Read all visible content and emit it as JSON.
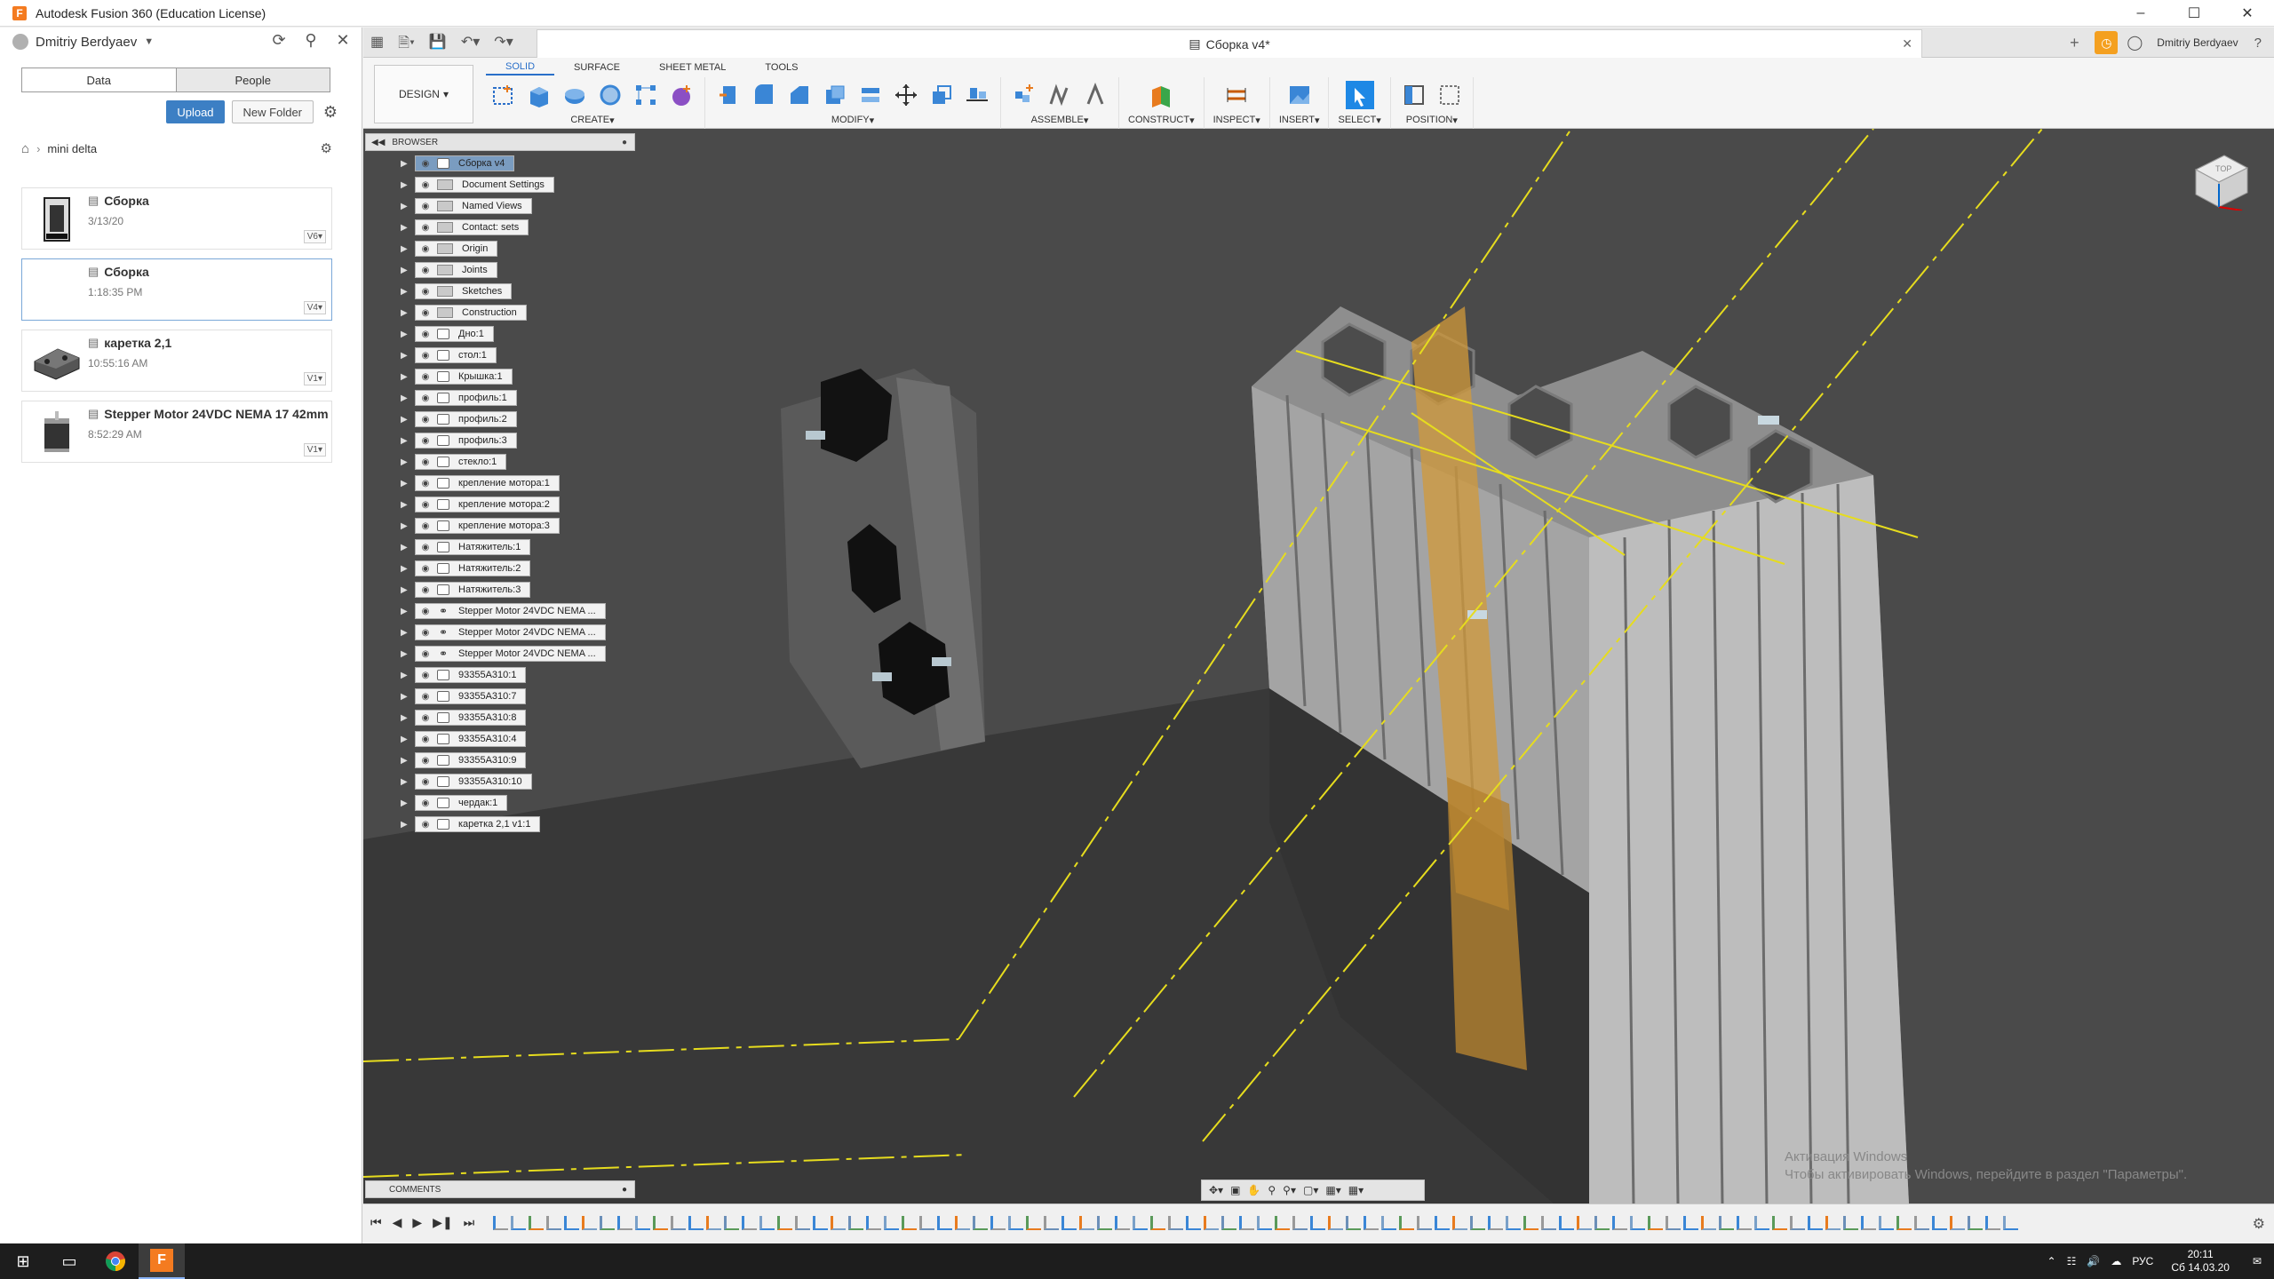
{
  "window": {
    "title": "Autodesk Fusion 360 (Education License)",
    "app_icon": "F"
  },
  "datapanel": {
    "user": "Dmitriy Berdyaev",
    "tabs": [
      "Data",
      "People"
    ],
    "upload_label": "Upload",
    "new_folder_label": "New Folder",
    "breadcrumb": "mini delta",
    "files": [
      {
        "name": "Сборка",
        "date": "3/13/20",
        "version": "V6"
      },
      {
        "name": "Сборка",
        "date": "1:18:35 PM",
        "version": "V4"
      },
      {
        "name": "каретка 2,1",
        "date": "10:55:16 AM",
        "version": "V1"
      },
      {
        "name": "Stepper Motor 24VDC NEMA 17 42mm",
        "date": "8:52:29 AM",
        "version": "V1"
      }
    ]
  },
  "doctab": {
    "title": "Сборка v4*"
  },
  "user_short": "Dmitriy Berdyaev",
  "toolbar": {
    "workspace": "DESIGN",
    "tabs": [
      "SOLID",
      "SURFACE",
      "SHEET METAL",
      "TOOLS"
    ],
    "groups": [
      "CREATE",
      "MODIFY",
      "ASSEMBLE",
      "CONSTRUCT",
      "INSPECT",
      "INSERT",
      "SELECT",
      "POSITION"
    ]
  },
  "browser": {
    "title": "BROWSER",
    "root": "Сборка v4",
    "items": [
      "Document Settings",
      "Named Views",
      "Contact: sets",
      "Origin",
      "Joints",
      "Sketches",
      "Construction",
      "Дно:1",
      "стол:1",
      "Крышка:1",
      "профиль:1",
      "профиль:2",
      "профиль:3",
      "стекло:1",
      "крепление мотора:1",
      "крепление мотора:2",
      "крепление мотора:3",
      "Натяжитель:1",
      "Натяжитель:2",
      "Натяжитель:3",
      "Stepper Motor 24VDC NEMA ...",
      "Stepper Motor 24VDC NEMA ...",
      "Stepper Motor 24VDC NEMA ...",
      "93355A310:1",
      "93355A310:7",
      "93355A310:8",
      "93355A310:4",
      "93355A310:9",
      "93355A310:10",
      "чердак:1",
      "каретка 2,1 v1:1"
    ]
  },
  "comments": {
    "title": "COMMENTS"
  },
  "watermark": {
    "line1": "Активация Windows",
    "line2": "Чтобы активировать Windows, перейдите в раздел \"Параметры\"."
  },
  "viewcube": {
    "face": "TOP"
  },
  "taskbar": {
    "lang": "РУС",
    "time": "20:11",
    "date": "Сб 14.03.20"
  }
}
